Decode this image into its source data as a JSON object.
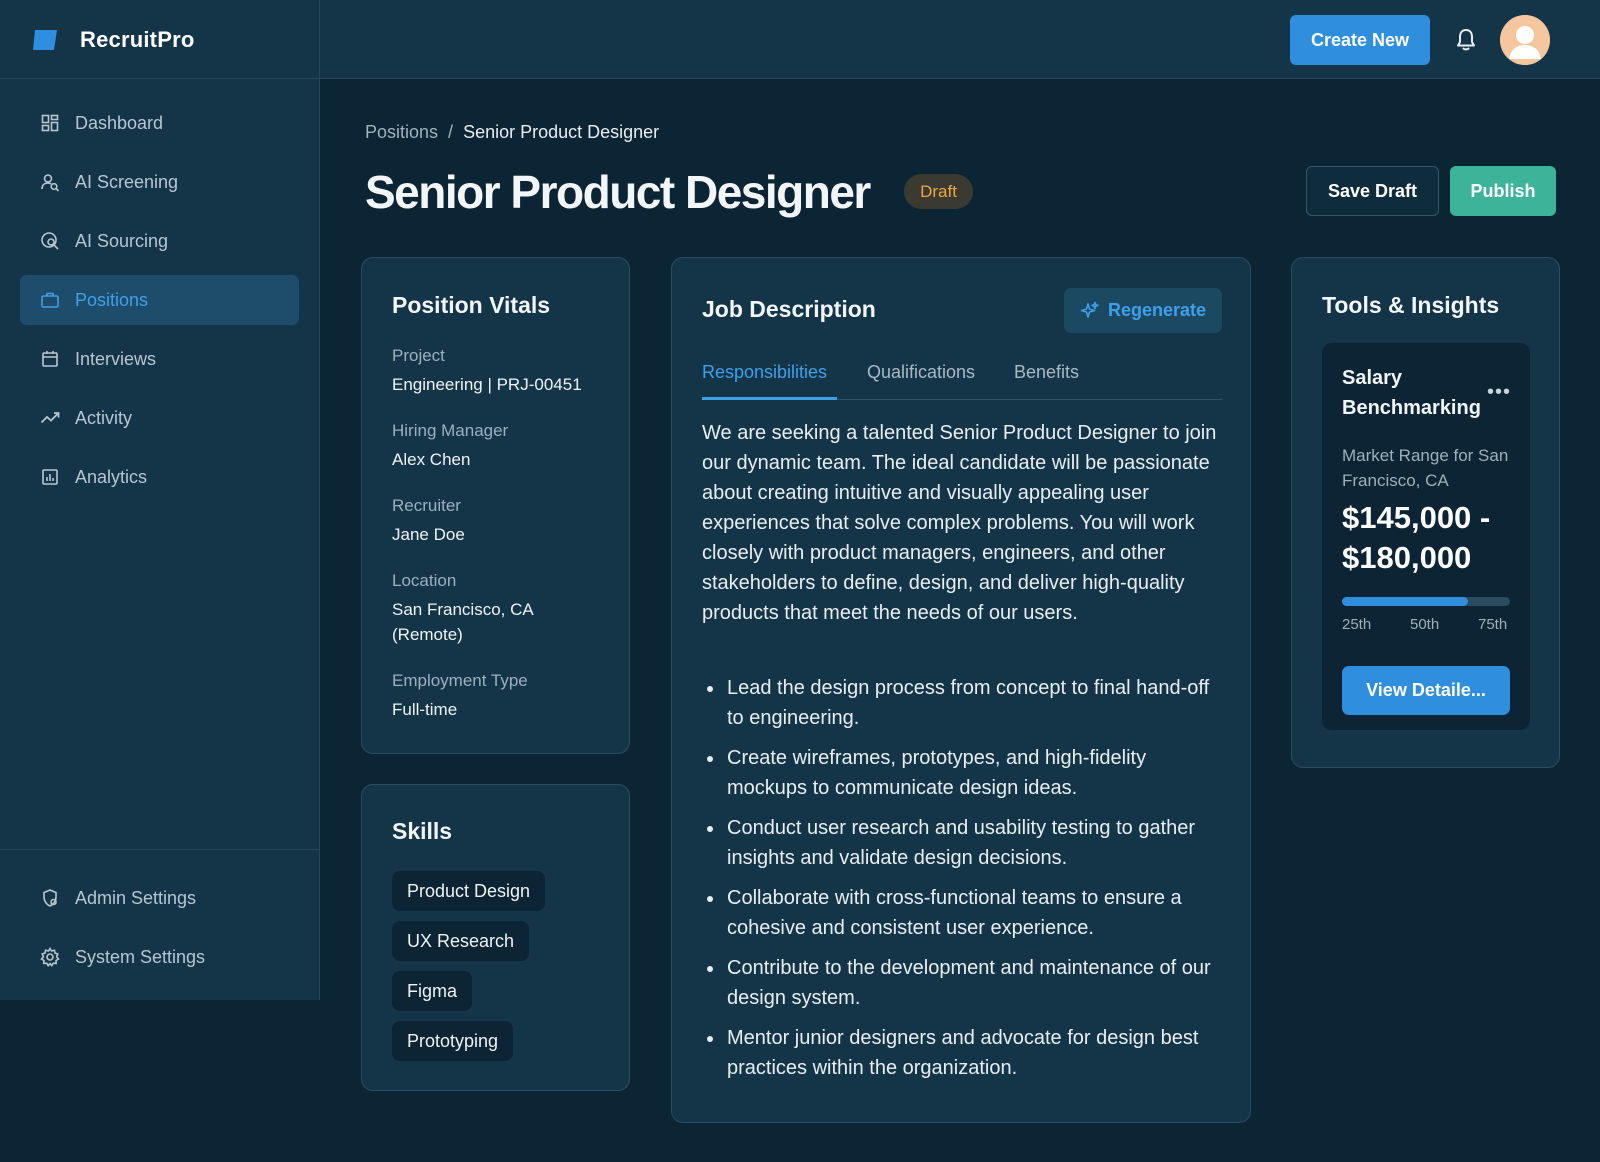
{
  "app": {
    "name": "RecruitPro"
  },
  "header": {
    "create_label": "Create New"
  },
  "sidebar": {
    "items": [
      {
        "label": "Dashboard",
        "icon": "dashboard-icon"
      },
      {
        "label": "AI Screening",
        "icon": "ai-screening-icon"
      },
      {
        "label": "AI Sourcing",
        "icon": "ai-sourcing-icon"
      },
      {
        "label": "Positions",
        "icon": "briefcase-icon",
        "active": true
      },
      {
        "label": "Interviews",
        "icon": "calendar-icon"
      },
      {
        "label": "Activity",
        "icon": "activity-icon"
      },
      {
        "label": "Analytics",
        "icon": "analytics-icon"
      }
    ],
    "bottom_items": [
      {
        "label": "Admin Settings",
        "icon": "admin-settings-icon"
      },
      {
        "label": "System Settings",
        "icon": "gear-icon"
      }
    ]
  },
  "breadcrumb": {
    "parent": "Positions",
    "separator": "/",
    "current": "Senior Product Designer"
  },
  "page": {
    "title": "Senior Product Designer",
    "status": "Draft",
    "save_label": "Save Draft",
    "publish_label": "Publish"
  },
  "vitals": {
    "title": "Position Vitals",
    "fields": [
      {
        "label": "Project",
        "value": "Engineering | PRJ-00451"
      },
      {
        "label": "Hiring Manager",
        "value": "Alex Chen"
      },
      {
        "label": "Recruiter",
        "value": "Jane Doe"
      },
      {
        "label": "Location",
        "value": "San Francisco, CA (Remote)"
      },
      {
        "label": "Employment Type",
        "value": "Full-time"
      }
    ]
  },
  "skills": {
    "title": "Skills",
    "items": [
      "Product Design",
      "UX Research",
      "Figma",
      "Prototyping"
    ]
  },
  "job_description": {
    "title": "Job Description",
    "regenerate_label": "Regenerate",
    "tabs": [
      "Responsibilities",
      "Qualifications",
      "Benefits"
    ],
    "active_tab": "Responsibilities",
    "intro": "We are seeking a talented Senior Product Designer to join our dynamic team. The ideal candidate will be passionate about creating intuitive and visually appealing user experiences that solve complex problems. You will work closely with product managers, engineers, and other stakeholders to define, design, and deliver high-quality products that meet the needs of our users.",
    "bullets": [
      "Lead the design process from concept to final hand-off to engineering.",
      "Create wireframes, prototypes, and high-fidelity mockups to communicate design ideas.",
      "Conduct user research and usability testing to gather insights and validate design decisions.",
      "Collaborate with cross-functional teams to ensure a cohesive and consistent user experience.",
      "Contribute to the development and maintenance of our design system.",
      "Mentor junior designers and advocate for design best practices within the organization."
    ]
  },
  "tools": {
    "title": "Tools & Insights",
    "salary": {
      "title": "Salary Benchmarking",
      "menu": "•••",
      "range_label": "Market Range for San Francisco, CA",
      "range_value": "$145,000 - $180,000",
      "percentiles": [
        "25th",
        "50th",
        "75th"
      ],
      "bar_fill_fraction": 0.75,
      "view_label": "View Detaile..."
    }
  },
  "colors": {
    "background": "#0c2535",
    "panel": "#143548",
    "accent": "#2f8fde",
    "publish": "#3db39a",
    "draft": "#f0a545"
  }
}
